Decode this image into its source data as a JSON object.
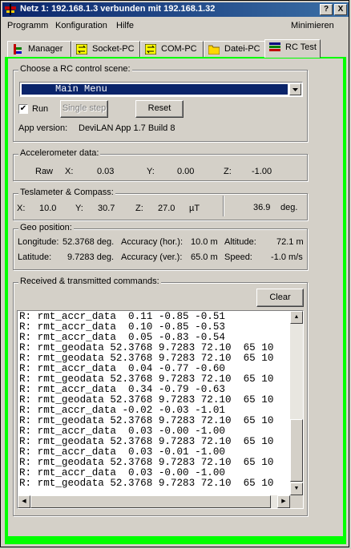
{
  "window": {
    "title": "Netz 1: 192.168.1.3  verbunden mit 192.168.1.32",
    "help_btn": "?",
    "close_btn": "X"
  },
  "menu": {
    "programm": "Programm",
    "konfiguration": "Konfiguration",
    "hilfe": "Hilfe",
    "minimieren": "Minimieren"
  },
  "tabs": [
    {
      "label": "Manager"
    },
    {
      "label": "Socket-PC"
    },
    {
      "label": "COM-PC"
    },
    {
      "label": "Datei-PC"
    },
    {
      "label": "RC Test"
    }
  ],
  "scene": {
    "label": "Choose a RC control scene:",
    "selected": "Main Menu",
    "run_label": "Run",
    "run_checked": true,
    "single_step_label": "Single step",
    "reset_label": "Reset",
    "app_version_label": "App version:",
    "app_version_value": "DeviLAN App 1.7 Build 8"
  },
  "accel": {
    "label": "Accelerometer data:",
    "raw": "Raw",
    "x_label": "X:",
    "x": "0.03",
    "y_label": "Y:",
    "y": "0.00",
    "z_label": "Z:",
    "z": "-1.00"
  },
  "tesla": {
    "label": "Teslameter  &  Compass:",
    "x_label": "X:",
    "x": "10.0",
    "y_label": "Y:",
    "y": "30.7",
    "z_label": "Z:",
    "z": "27.0",
    "unit": "µT",
    "heading": "36.9",
    "deg": "deg."
  },
  "geo": {
    "label": "Geo position:",
    "lon_label": "Longitude:",
    "lon": "52.3768 deg.",
    "acc_hor_label": "Accuracy (hor.):",
    "acc_hor": "10.0 m",
    "alt_label": "Altitude:",
    "alt": "72.1 m",
    "lat_label": "Latitude:",
    "lat": "9.7283 deg.",
    "acc_ver_label": "Accuracy (ver.):",
    "acc_ver": "65.0 m",
    "speed_label": "Speed:",
    "speed": "-1.0 m/s"
  },
  "commands": {
    "label": "Received & transmitted commands:",
    "clear_label": "Clear",
    "lines": [
      "R: rmt_accr_data  0.11 -0.85 -0.51",
      "R: rmt_accr_data  0.10 -0.85 -0.53",
      "R: rmt_accr_data  0.05 -0.83 -0.54",
      "R: rmt_geodata 52.3768 9.7283 72.10  65 10",
      "R: rmt_geodata 52.3768 9.7283 72.10  65 10",
      "R: rmt_accr_data  0.04 -0.77 -0.60",
      "R: rmt_geodata 52.3768 9.7283 72.10  65 10",
      "R: rmt_accr_data  0.34 -0.79 -0.63",
      "R: rmt_geodata 52.3768 9.7283 72.10  65 10",
      "R: rmt_accr_data -0.02 -0.03 -1.01",
      "R: rmt_geodata 52.3768 9.7283 72.10  65 10",
      "R: rmt_accr_data  0.03 -0.00 -1.00",
      "R: rmt_geodata 52.3768 9.7283 72.10  65 10",
      "R: rmt_accr_data  0.03 -0.01 -1.00",
      "R: rmt_geodata 52.3768 9.7283 72.10  65 10",
      "R: rmt_accr_data  0.03 -0.00 -1.00",
      "R: rmt_geodata 52.3768 9.7283 72.10  65 10"
    ]
  },
  "colors": {
    "title_bar": "#0a246a",
    "accent_border": "#00ff00",
    "selection": "#0a246a"
  }
}
